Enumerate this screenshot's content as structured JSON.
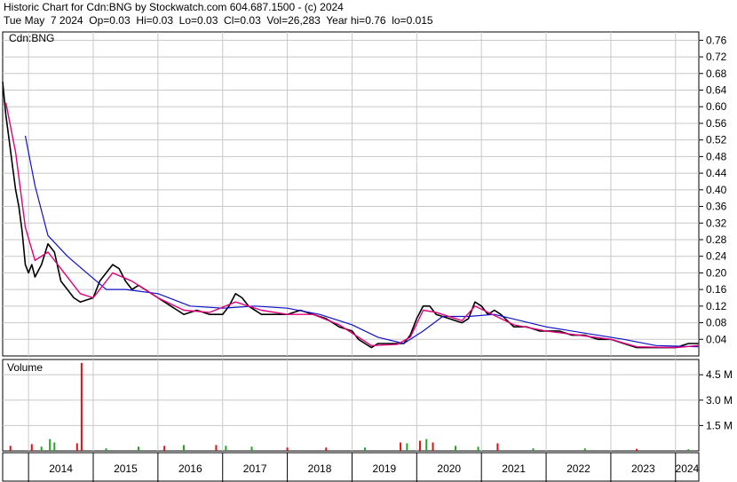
{
  "header": {
    "line1": "Historic Chart for Cdn:BNG by Stockwatch.com 604.687.1500 - (c) 2024",
    "line2": "Tue May  7 2024  Op=0.03  Hi=0.03  Lo=0.03  Cl=0.03  Vol=26,283  Year hi=0.76  lo=0.015"
  },
  "chart_data": {
    "type": "line",
    "symbol_label": "Cdn:BNG",
    "volume_label": "Volume",
    "x_years": [
      "2014",
      "2015",
      "2016",
      "2017",
      "2018",
      "2019",
      "2020",
      "2021",
      "2022",
      "2023",
      "2024"
    ],
    "x_range": [
      2013.6,
      2024.36
    ],
    "price_ticks": [
      "0.04",
      "0.08",
      "0.12",
      "0.16",
      "0.20",
      "0.24",
      "0.28",
      "0.32",
      "0.36",
      "0.40",
      "0.44",
      "0.48",
      "0.52",
      "0.56",
      "0.60",
      "0.64",
      "0.68",
      "0.72",
      "0.76"
    ],
    "ylim_price": [
      0.0,
      0.78
    ],
    "volume_ticks": [
      "1.5 M",
      "3.0 M",
      "4.5 M"
    ],
    "ylim_volume": [
      0,
      5.4
    ],
    "grid": true,
    "colors": {
      "price": "#000000",
      "ma_short": "#e0007a",
      "ma_long": "#1010c8",
      "vol_up": "#2aa02a",
      "vol_down": "#dd1111",
      "grid": "#c8c8c8"
    },
    "price": [
      {
        "x": 2013.6,
        "y": 0.66
      },
      {
        "x": 2013.65,
        "y": 0.58
      },
      {
        "x": 2013.7,
        "y": 0.52
      },
      {
        "x": 2013.75,
        "y": 0.46
      },
      {
        "x": 2013.8,
        "y": 0.4
      },
      {
        "x": 2013.85,
        "y": 0.36
      },
      {
        "x": 2013.9,
        "y": 0.3
      },
      {
        "x": 2013.95,
        "y": 0.22
      },
      {
        "x": 2014.0,
        "y": 0.2
      },
      {
        "x": 2014.05,
        "y": 0.22
      },
      {
        "x": 2014.1,
        "y": 0.19
      },
      {
        "x": 2014.2,
        "y": 0.22
      },
      {
        "x": 2014.3,
        "y": 0.27
      },
      {
        "x": 2014.4,
        "y": 0.25
      },
      {
        "x": 2014.5,
        "y": 0.18
      },
      {
        "x": 2014.6,
        "y": 0.16
      },
      {
        "x": 2014.7,
        "y": 0.14
      },
      {
        "x": 2014.8,
        "y": 0.13
      },
      {
        "x": 2015.0,
        "y": 0.14
      },
      {
        "x": 2015.1,
        "y": 0.18
      },
      {
        "x": 2015.2,
        "y": 0.2
      },
      {
        "x": 2015.3,
        "y": 0.22
      },
      {
        "x": 2015.4,
        "y": 0.21
      },
      {
        "x": 2015.5,
        "y": 0.18
      },
      {
        "x": 2015.6,
        "y": 0.16
      },
      {
        "x": 2015.7,
        "y": 0.17
      },
      {
        "x": 2015.8,
        "y": 0.16
      },
      {
        "x": 2016.0,
        "y": 0.14
      },
      {
        "x": 2016.1,
        "y": 0.13
      },
      {
        "x": 2016.2,
        "y": 0.12
      },
      {
        "x": 2016.3,
        "y": 0.11
      },
      {
        "x": 2016.4,
        "y": 0.1
      },
      {
        "x": 2016.6,
        "y": 0.11
      },
      {
        "x": 2016.8,
        "y": 0.1
      },
      {
        "x": 2017.0,
        "y": 0.1
      },
      {
        "x": 2017.1,
        "y": 0.12
      },
      {
        "x": 2017.2,
        "y": 0.15
      },
      {
        "x": 2017.3,
        "y": 0.14
      },
      {
        "x": 2017.4,
        "y": 0.12
      },
      {
        "x": 2017.6,
        "y": 0.1
      },
      {
        "x": 2017.8,
        "y": 0.1
      },
      {
        "x": 2018.0,
        "y": 0.1
      },
      {
        "x": 2018.2,
        "y": 0.11
      },
      {
        "x": 2018.4,
        "y": 0.1
      },
      {
        "x": 2018.6,
        "y": 0.09
      },
      {
        "x": 2018.8,
        "y": 0.07
      },
      {
        "x": 2019.0,
        "y": 0.06
      },
      {
        "x": 2019.1,
        "y": 0.04
      },
      {
        "x": 2019.2,
        "y": 0.03
      },
      {
        "x": 2019.3,
        "y": 0.02
      },
      {
        "x": 2019.4,
        "y": 0.03
      },
      {
        "x": 2019.6,
        "y": 0.03
      },
      {
        "x": 2019.8,
        "y": 0.03
      },
      {
        "x": 2019.9,
        "y": 0.05
      },
      {
        "x": 2020.0,
        "y": 0.09
      },
      {
        "x": 2020.1,
        "y": 0.12
      },
      {
        "x": 2020.2,
        "y": 0.12
      },
      {
        "x": 2020.3,
        "y": 0.1
      },
      {
        "x": 2020.5,
        "y": 0.09
      },
      {
        "x": 2020.7,
        "y": 0.08
      },
      {
        "x": 2020.8,
        "y": 0.09
      },
      {
        "x": 2020.9,
        "y": 0.13
      },
      {
        "x": 2021.0,
        "y": 0.12
      },
      {
        "x": 2021.1,
        "y": 0.1
      },
      {
        "x": 2021.2,
        "y": 0.11
      },
      {
        "x": 2021.3,
        "y": 0.1
      },
      {
        "x": 2021.5,
        "y": 0.07
      },
      {
        "x": 2021.7,
        "y": 0.07
      },
      {
        "x": 2021.9,
        "y": 0.06
      },
      {
        "x": 2022.0,
        "y": 0.06
      },
      {
        "x": 2022.2,
        "y": 0.06
      },
      {
        "x": 2022.4,
        "y": 0.05
      },
      {
        "x": 2022.6,
        "y": 0.05
      },
      {
        "x": 2022.8,
        "y": 0.04
      },
      {
        "x": 2023.0,
        "y": 0.04
      },
      {
        "x": 2023.2,
        "y": 0.03
      },
      {
        "x": 2023.4,
        "y": 0.02
      },
      {
        "x": 2023.6,
        "y": 0.02
      },
      {
        "x": 2023.8,
        "y": 0.02
      },
      {
        "x": 2024.0,
        "y": 0.02
      },
      {
        "x": 2024.2,
        "y": 0.03
      },
      {
        "x": 2024.35,
        "y": 0.03
      }
    ],
    "ma_short": [
      {
        "x": 2013.65,
        "y": 0.61
      },
      {
        "x": 2013.8,
        "y": 0.49
      },
      {
        "x": 2013.95,
        "y": 0.31
      },
      {
        "x": 2014.1,
        "y": 0.23
      },
      {
        "x": 2014.3,
        "y": 0.25
      },
      {
        "x": 2014.5,
        "y": 0.21
      },
      {
        "x": 2014.8,
        "y": 0.15
      },
      {
        "x": 2015.0,
        "y": 0.14
      },
      {
        "x": 2015.3,
        "y": 0.2
      },
      {
        "x": 2015.6,
        "y": 0.18
      },
      {
        "x": 2016.0,
        "y": 0.14
      },
      {
        "x": 2016.4,
        "y": 0.11
      },
      {
        "x": 2016.8,
        "y": 0.105
      },
      {
        "x": 2017.2,
        "y": 0.13
      },
      {
        "x": 2017.6,
        "y": 0.11
      },
      {
        "x": 2018.0,
        "y": 0.1
      },
      {
        "x": 2018.4,
        "y": 0.1
      },
      {
        "x": 2018.8,
        "y": 0.075
      },
      {
        "x": 2019.1,
        "y": 0.045
      },
      {
        "x": 2019.3,
        "y": 0.025
      },
      {
        "x": 2019.7,
        "y": 0.028
      },
      {
        "x": 2019.9,
        "y": 0.045
      },
      {
        "x": 2020.1,
        "y": 0.11
      },
      {
        "x": 2020.3,
        "y": 0.105
      },
      {
        "x": 2020.7,
        "y": 0.085
      },
      {
        "x": 2020.9,
        "y": 0.12
      },
      {
        "x": 2021.1,
        "y": 0.105
      },
      {
        "x": 2021.5,
        "y": 0.075
      },
      {
        "x": 2022.0,
        "y": 0.06
      },
      {
        "x": 2022.6,
        "y": 0.048
      },
      {
        "x": 2023.0,
        "y": 0.04
      },
      {
        "x": 2023.4,
        "y": 0.022
      },
      {
        "x": 2024.0,
        "y": 0.02
      },
      {
        "x": 2024.35,
        "y": 0.025
      }
    ],
    "ma_long": [
      {
        "x": 2013.95,
        "y": 0.53
      },
      {
        "x": 2014.1,
        "y": 0.41
      },
      {
        "x": 2014.3,
        "y": 0.29
      },
      {
        "x": 2014.6,
        "y": 0.24
      },
      {
        "x": 2014.9,
        "y": 0.2
      },
      {
        "x": 2015.2,
        "y": 0.16
      },
      {
        "x": 2015.5,
        "y": 0.16
      },
      {
        "x": 2016.0,
        "y": 0.15
      },
      {
        "x": 2016.5,
        "y": 0.12
      },
      {
        "x": 2017.0,
        "y": 0.115
      },
      {
        "x": 2017.5,
        "y": 0.12
      },
      {
        "x": 2018.0,
        "y": 0.115
      },
      {
        "x": 2018.5,
        "y": 0.1
      },
      {
        "x": 2019.0,
        "y": 0.075
      },
      {
        "x": 2019.4,
        "y": 0.045
      },
      {
        "x": 2019.8,
        "y": 0.03
      },
      {
        "x": 2020.1,
        "y": 0.06
      },
      {
        "x": 2020.4,
        "y": 0.095
      },
      {
        "x": 2020.8,
        "y": 0.095
      },
      {
        "x": 2021.2,
        "y": 0.1
      },
      {
        "x": 2021.6,
        "y": 0.085
      },
      {
        "x": 2022.0,
        "y": 0.07
      },
      {
        "x": 2022.6,
        "y": 0.055
      },
      {
        "x": 2023.2,
        "y": 0.04
      },
      {
        "x": 2023.7,
        "y": 0.025
      },
      {
        "x": 2024.35,
        "y": 0.022
      }
    ],
    "volume": [
      {
        "x": 2013.72,
        "v": 0.3,
        "c": "down"
      },
      {
        "x": 2014.05,
        "v": 0.4,
        "c": "down"
      },
      {
        "x": 2014.2,
        "v": 0.25,
        "c": "up"
      },
      {
        "x": 2014.33,
        "v": 0.7,
        "c": "up"
      },
      {
        "x": 2014.4,
        "v": 0.5,
        "c": "up"
      },
      {
        "x": 2014.75,
        "v": 0.45,
        "c": "down"
      },
      {
        "x": 2014.82,
        "v": 5.2,
        "c": "down"
      },
      {
        "x": 2015.2,
        "v": 0.15,
        "c": "up"
      },
      {
        "x": 2015.7,
        "v": 0.25,
        "c": "up"
      },
      {
        "x": 2016.1,
        "v": 0.3,
        "c": "down"
      },
      {
        "x": 2016.4,
        "v": 0.35,
        "c": "up"
      },
      {
        "x": 2016.9,
        "v": 0.35,
        "c": "down"
      },
      {
        "x": 2017.05,
        "v": 0.3,
        "c": "up"
      },
      {
        "x": 2017.45,
        "v": 0.25,
        "c": "up"
      },
      {
        "x": 2018.0,
        "v": 0.2,
        "c": "down"
      },
      {
        "x": 2018.6,
        "v": 0.2,
        "c": "down"
      },
      {
        "x": 2019.2,
        "v": 0.2,
        "c": "up"
      },
      {
        "x": 2019.75,
        "v": 0.5,
        "c": "down"
      },
      {
        "x": 2019.85,
        "v": 0.45,
        "c": "up"
      },
      {
        "x": 2020.05,
        "v": 0.6,
        "c": "down"
      },
      {
        "x": 2020.15,
        "v": 0.7,
        "c": "up"
      },
      {
        "x": 2020.25,
        "v": 0.5,
        "c": "down"
      },
      {
        "x": 2020.6,
        "v": 0.3,
        "c": "up"
      },
      {
        "x": 2020.95,
        "v": 0.25,
        "c": "up"
      },
      {
        "x": 2021.25,
        "v": 0.45,
        "c": "down"
      },
      {
        "x": 2021.8,
        "v": 0.15,
        "c": "up"
      },
      {
        "x": 2022.6,
        "v": 0.15,
        "c": "up"
      },
      {
        "x": 2023.4,
        "v": 0.12,
        "c": "down"
      },
      {
        "x": 2024.2,
        "v": 0.1,
        "c": "up"
      }
    ]
  }
}
